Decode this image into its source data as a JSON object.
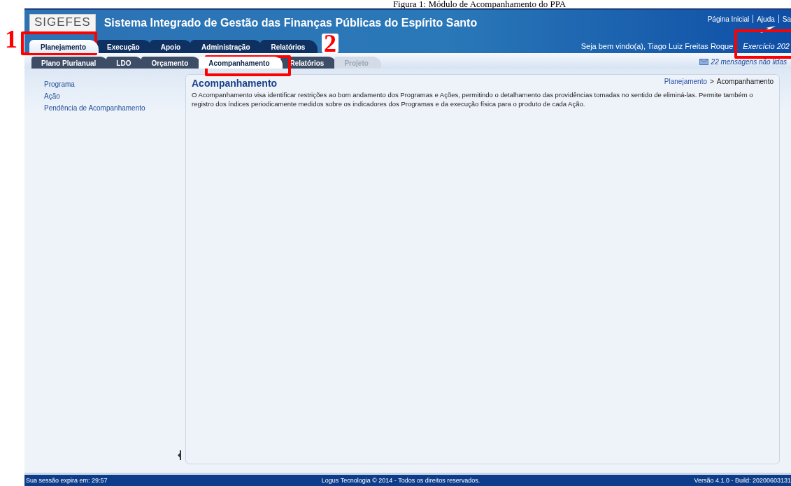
{
  "caption": "Figura 1: Módulo de Acompanhamento do PPA",
  "header": {
    "logo": "SIGEFES",
    "title": "Sistema Integrado de Gestão das Finanças Públicas do Espírito Santo",
    "links": [
      "Página Inicial",
      "Ajuda",
      "Sa"
    ],
    "welcome": "Seja bem vindo(a), Tiago Luiz Freitas Roque",
    "exercise": "Exercício 202"
  },
  "main_tabs": [
    {
      "label": "Planejamento",
      "selected": true
    },
    {
      "label": "Execução",
      "selected": false
    },
    {
      "label": "Apoio",
      "selected": false
    },
    {
      "label": "Administração",
      "selected": false
    },
    {
      "label": "Relatórios",
      "selected": false
    }
  ],
  "sub_tabs": [
    {
      "label": "Plano Plurianual",
      "selected": false,
      "disabled": false
    },
    {
      "label": "LDO",
      "selected": false,
      "disabled": false
    },
    {
      "label": "Orçamento",
      "selected": false,
      "disabled": false
    },
    {
      "label": "Acompanhamento",
      "selected": true,
      "disabled": false
    },
    {
      "label": "Relatórios",
      "selected": false,
      "disabled": false
    },
    {
      "label": "Projeto",
      "selected": false,
      "disabled": true
    }
  ],
  "messages": "22 mensagens não lidas",
  "sidebar": {
    "items": [
      "Programa",
      "Ação",
      "Pendência de Acompanhamento"
    ]
  },
  "panel": {
    "title": "Acompanhamento",
    "breadcrumb": [
      "Planejamento",
      "Acompanhamento"
    ],
    "breadcrumb_separator": ">",
    "description": "O Acompanhamento visa identificar restrições ao bom andamento dos Programas e Ações, permitindo o detalhamento das providências tomadas no sentido de eliminá-las. Permite também o registro dos índices periodicamente medidos sobre os indicadores dos Programas e da execução física para o produto de cada Ação."
  },
  "status_bar": {
    "session": "Sua sessão expira em: 29:57",
    "copyright": "Logus Tecnologia © 2014 - Todos os direitos reservados.",
    "version": "Versão 4.1.0 - Build: 20200603131"
  },
  "annotations": [
    {
      "kind": "numbered",
      "label": "1"
    },
    {
      "kind": "numbered",
      "label": "2"
    },
    {
      "kind": "plain"
    }
  ]
}
